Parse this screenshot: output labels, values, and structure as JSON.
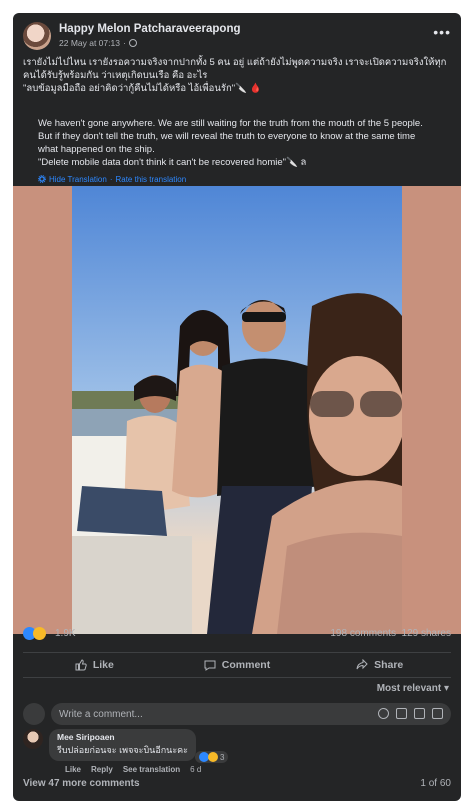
{
  "post": {
    "author": "Happy Melon Patcharaveerapong",
    "date": "22 May at 07:13",
    "date_sep": "·",
    "more": "•••",
    "text": "เรายังไม่ไปไหน  เรายังรอความจริงจากปากทั้ง 5 คน อยู่ แต่ถ้ายังไม่พูดความจริง เราจะเปิดความจริงให้ทุก\nคนได้รับรู้พร้อมกัน  ว่าเหตุเกิดบนเรือ  คือ อะไร\n\"ลบข้อมูลมือถือ อย่าคิดว่ากู้คืนไม่ได้หรือ ไอ้เพื่อนรัก\"🔪 🩸",
    "translation": "We haven't gone anywhere. We are still waiting for the truth from the mouth of the 5 people.\nBut if they don't tell the truth, we will reveal the truth to everyone to know at the same time\nwhat happened on the ship.\n\"Delete mobile data don't think it can't be recovered homie\"🔪 ล",
    "hide_translation": "Hide Translation",
    "link_sep": "·",
    "rate_translation": "Rate this translation"
  },
  "stats": {
    "reactions": "1.9K",
    "comments": "198 comments",
    "shares": "129 shares"
  },
  "actions": {
    "like": "Like",
    "comment": "Comment",
    "share": "Share"
  },
  "sort": {
    "label": "Most relevant"
  },
  "composer": {
    "placeholder": "Write a comment..."
  },
  "comment": {
    "name": "Mee Siripoaen",
    "text": "รีบปล่อยก่อนจะ เพจจะบินอีกนะคะ",
    "react_count": "3",
    "like": "Like",
    "reply": "Reply",
    "see_translation": "See translation",
    "time": "6 d"
  },
  "footer": {
    "view_more": "View 47 more comments",
    "paging": "1 of 60"
  },
  "colors": {
    "card_bg": "#242526",
    "input_bg": "#3a3b3c",
    "text_primary": "#e4e6eb",
    "text_secondary": "#b0b3b8",
    "link": "#2d88ff",
    "photo_frame": "#c8917d"
  }
}
